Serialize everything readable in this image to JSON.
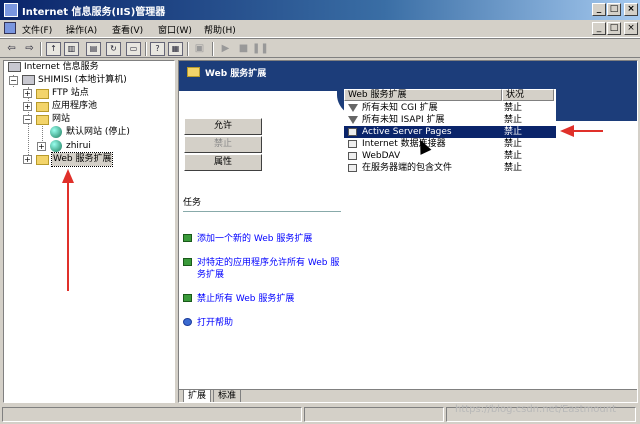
{
  "window": {
    "title": "Internet 信息服务(IIS)管理器",
    "buttons": {
      "minimize": "_",
      "maximize": "□",
      "close": "×"
    }
  },
  "menubar": {
    "items": [
      "文件(F)",
      "操作(A)",
      "查看(V)",
      "窗口(W)",
      "帮助(H)"
    ]
  },
  "toolbar": {
    "icons": [
      "back-icon",
      "forward-icon",
      "up-folder-icon",
      "show-hide-tree-icon",
      "properties-icon",
      "refresh-icon",
      "export-list-icon",
      "help-icon",
      "console-icon",
      "computer-icon",
      "play-icon",
      "stop-icon",
      "pause-icon"
    ]
  },
  "tree": {
    "root": "Internet 信息服务",
    "computer": "SHIMISI (本地计算机)",
    "ftp": "FTP 站点",
    "app_pools": "应用程序池",
    "websites": "网站",
    "default_site": "默认网站 (停止)",
    "zhirui": "zhirui",
    "web_ext": "Web 服务扩展"
  },
  "header": {
    "title": "Web 服务扩展"
  },
  "actions": {
    "allow": "允许",
    "deny": "禁止",
    "properties": "属性"
  },
  "tasks": {
    "title": "任务",
    "items": [
      "添加一个新的 Web 服务扩展",
      "对特定的应用程序允许所有 Web 服务扩展",
      "禁止所有 Web 服务扩展",
      "打开帮助"
    ]
  },
  "list": {
    "columns": {
      "name": "Web 服务扩展",
      "status": "状况"
    },
    "rows": [
      {
        "name": "所有未知 CGI 扩展",
        "status": "禁止"
      },
      {
        "name": "所有未知 ISAPI 扩展",
        "status": "禁止"
      },
      {
        "name": "Active Server Pages",
        "status": "禁止"
      },
      {
        "name": "Internet 数据连接器",
        "status": "禁止"
      },
      {
        "name": "WebDAV",
        "status": "禁止"
      },
      {
        "name": "在服务器端的包含文件",
        "status": "禁止"
      }
    ]
  },
  "tabs": {
    "extended": "扩展",
    "standard": "标准"
  },
  "watermark": "https://blog.csdn.net/Eastmount",
  "colors": {
    "selection": "#0a246a",
    "annotation_arrow": "#e0302a",
    "header_band": "#1c3d7a"
  }
}
